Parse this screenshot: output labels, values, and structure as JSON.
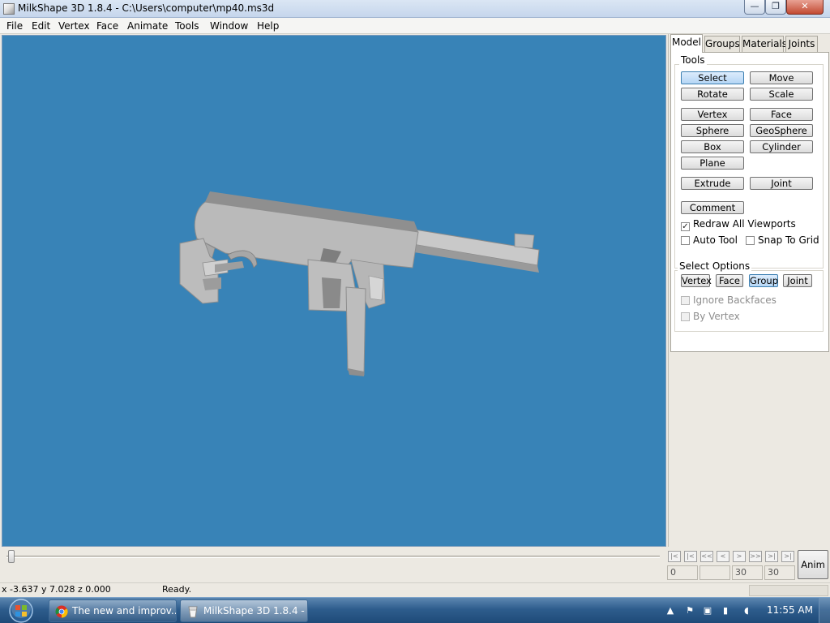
{
  "window": {
    "title": "MilkShape 3D 1.8.4 - C:\\Users\\computer\\mp40.ms3d",
    "min_glyph": "—",
    "max_glyph": "❐",
    "close_glyph": "✕"
  },
  "menu": [
    "File",
    "Edit",
    "Vertex",
    "Face",
    "Animate",
    "Tools",
    "Window",
    "Help"
  ],
  "viewport": {
    "background": "#3883b7"
  },
  "panel": {
    "tabs": [
      "Model",
      "Groups",
      "Materials",
      "Joints"
    ],
    "active_tab": "Model",
    "tools_label": "Tools",
    "tools": {
      "select": "Select",
      "move": "Move",
      "rotate": "Rotate",
      "scale": "Scale",
      "vertex": "Vertex",
      "face": "Face",
      "sphere": "Sphere",
      "geosphere": "GeoSphere",
      "box": "Box",
      "cylinder": "Cylinder",
      "plane": "Plane",
      "extrude": "Extrude",
      "joint": "Joint",
      "comment": "Comment"
    },
    "redraw_all": {
      "label": "Redraw All Viewports",
      "checked": true
    },
    "auto_tool": {
      "label": "Auto Tool",
      "checked": false
    },
    "snap_to_grid": {
      "label": "Snap To Grid",
      "checked": false
    },
    "select_options_label": "Select Options",
    "select_options": {
      "vertex": "Vertex",
      "face": "Face",
      "group": "Group",
      "joint": "Joint"
    },
    "selected_option": "Group",
    "ignore_backfaces": {
      "label": "Ignore Backfaces",
      "checked": false
    },
    "by_vertex": {
      "label": "By Vertex",
      "checked": false
    },
    "checkmark": "✓"
  },
  "timeline": {
    "nav_glyphs": [
      "|<",
      "|<",
      "<<",
      "<",
      ">",
      ">>",
      ">|",
      ">|"
    ],
    "current_frame": "0",
    "frame_field": "",
    "total_frames": "30",
    "end_frame": "30",
    "anim_label": "Anim"
  },
  "status": {
    "coords": "x -3.637 y 7.028 z 0.000",
    "message": "Ready."
  },
  "taskbar": {
    "items": [
      {
        "label": "The new and improv...",
        "icon": "chrome-icon"
      },
      {
        "label": "MilkShape 3D 1.8.4 - ...",
        "icon": "milkshape-icon"
      }
    ],
    "clock": "11:55 AM"
  }
}
